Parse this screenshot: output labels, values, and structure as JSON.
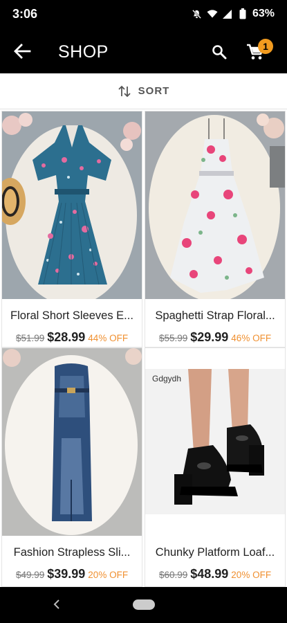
{
  "status_bar": {
    "time": "3:06",
    "battery": "63%"
  },
  "app_bar": {
    "title": "SHOP",
    "cart_count": "1"
  },
  "sort": {
    "label": "SORT"
  },
  "products": [
    {
      "name": "Floral Short Sleeves E...",
      "old_price": "$51.99",
      "price": "$28.99",
      "discount": "44% OFF"
    },
    {
      "name": "Spaghetti Strap Floral...",
      "old_price": "$55.99",
      "price": "$29.99",
      "discount": "46% OFF"
    },
    {
      "name": "Fashion Strapless Sli...",
      "old_price": "$49.99",
      "price": "$39.99",
      "discount": "20% OFF"
    },
    {
      "name": "Chunky Platform Loaf...",
      "old_price": "$60.99",
      "price": "$48.99",
      "discount": "20% OFF"
    }
  ],
  "image_text": {
    "shoe_brand": "Gdgydh"
  },
  "colors": {
    "accent": "#f29b1f",
    "discount": "#f09030",
    "bar": "#000000"
  },
  "icons": [
    "back-arrow-icon",
    "search-icon",
    "cart-icon",
    "sort-icon",
    "mute-icon",
    "wifi-icon",
    "signal-icon",
    "battery-icon"
  ]
}
